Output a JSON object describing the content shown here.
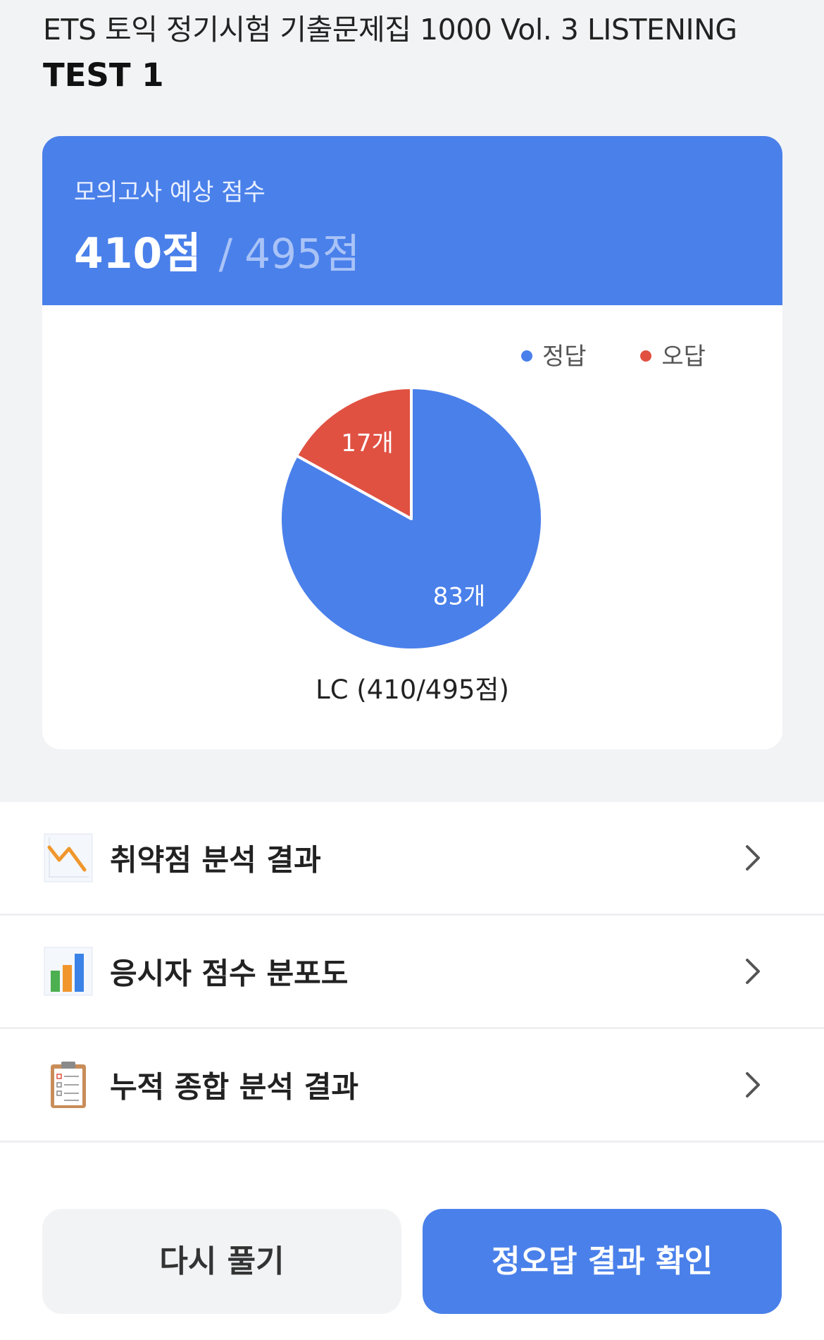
{
  "header": {
    "book_title": "ETS 토익 정기시험 기출문제집 1000 Vol. 3 LISTENING",
    "test_title": "TEST 1"
  },
  "score_card": {
    "label": "모의고사 예상 점수",
    "score": "410점",
    "separator": "/",
    "max_score": "495점"
  },
  "chart_data": {
    "type": "pie",
    "categories": [
      "정답",
      "오답"
    ],
    "values": [
      83,
      17
    ],
    "data_labels": [
      "83개",
      "17개"
    ],
    "colors": [
      "#4a80ea",
      "#e05142"
    ],
    "xlabel": "LC (410/495점)",
    "legend_position": "top-right"
  },
  "menu": [
    {
      "label": "취약점 분석 결과",
      "icon": "trend-down-icon"
    },
    {
      "label": "응시자 점수 분포도",
      "icon": "bar-chart-icon"
    },
    {
      "label": "누적 종합 분석 결과",
      "icon": "clipboard-icon"
    }
  ],
  "buttons": {
    "retry": "다시 풀기",
    "check_answers": "정오답 결과 확인"
  },
  "colors": {
    "accent": "#4a80ea",
    "wrong": "#e05142",
    "background": "#f2f3f5"
  }
}
